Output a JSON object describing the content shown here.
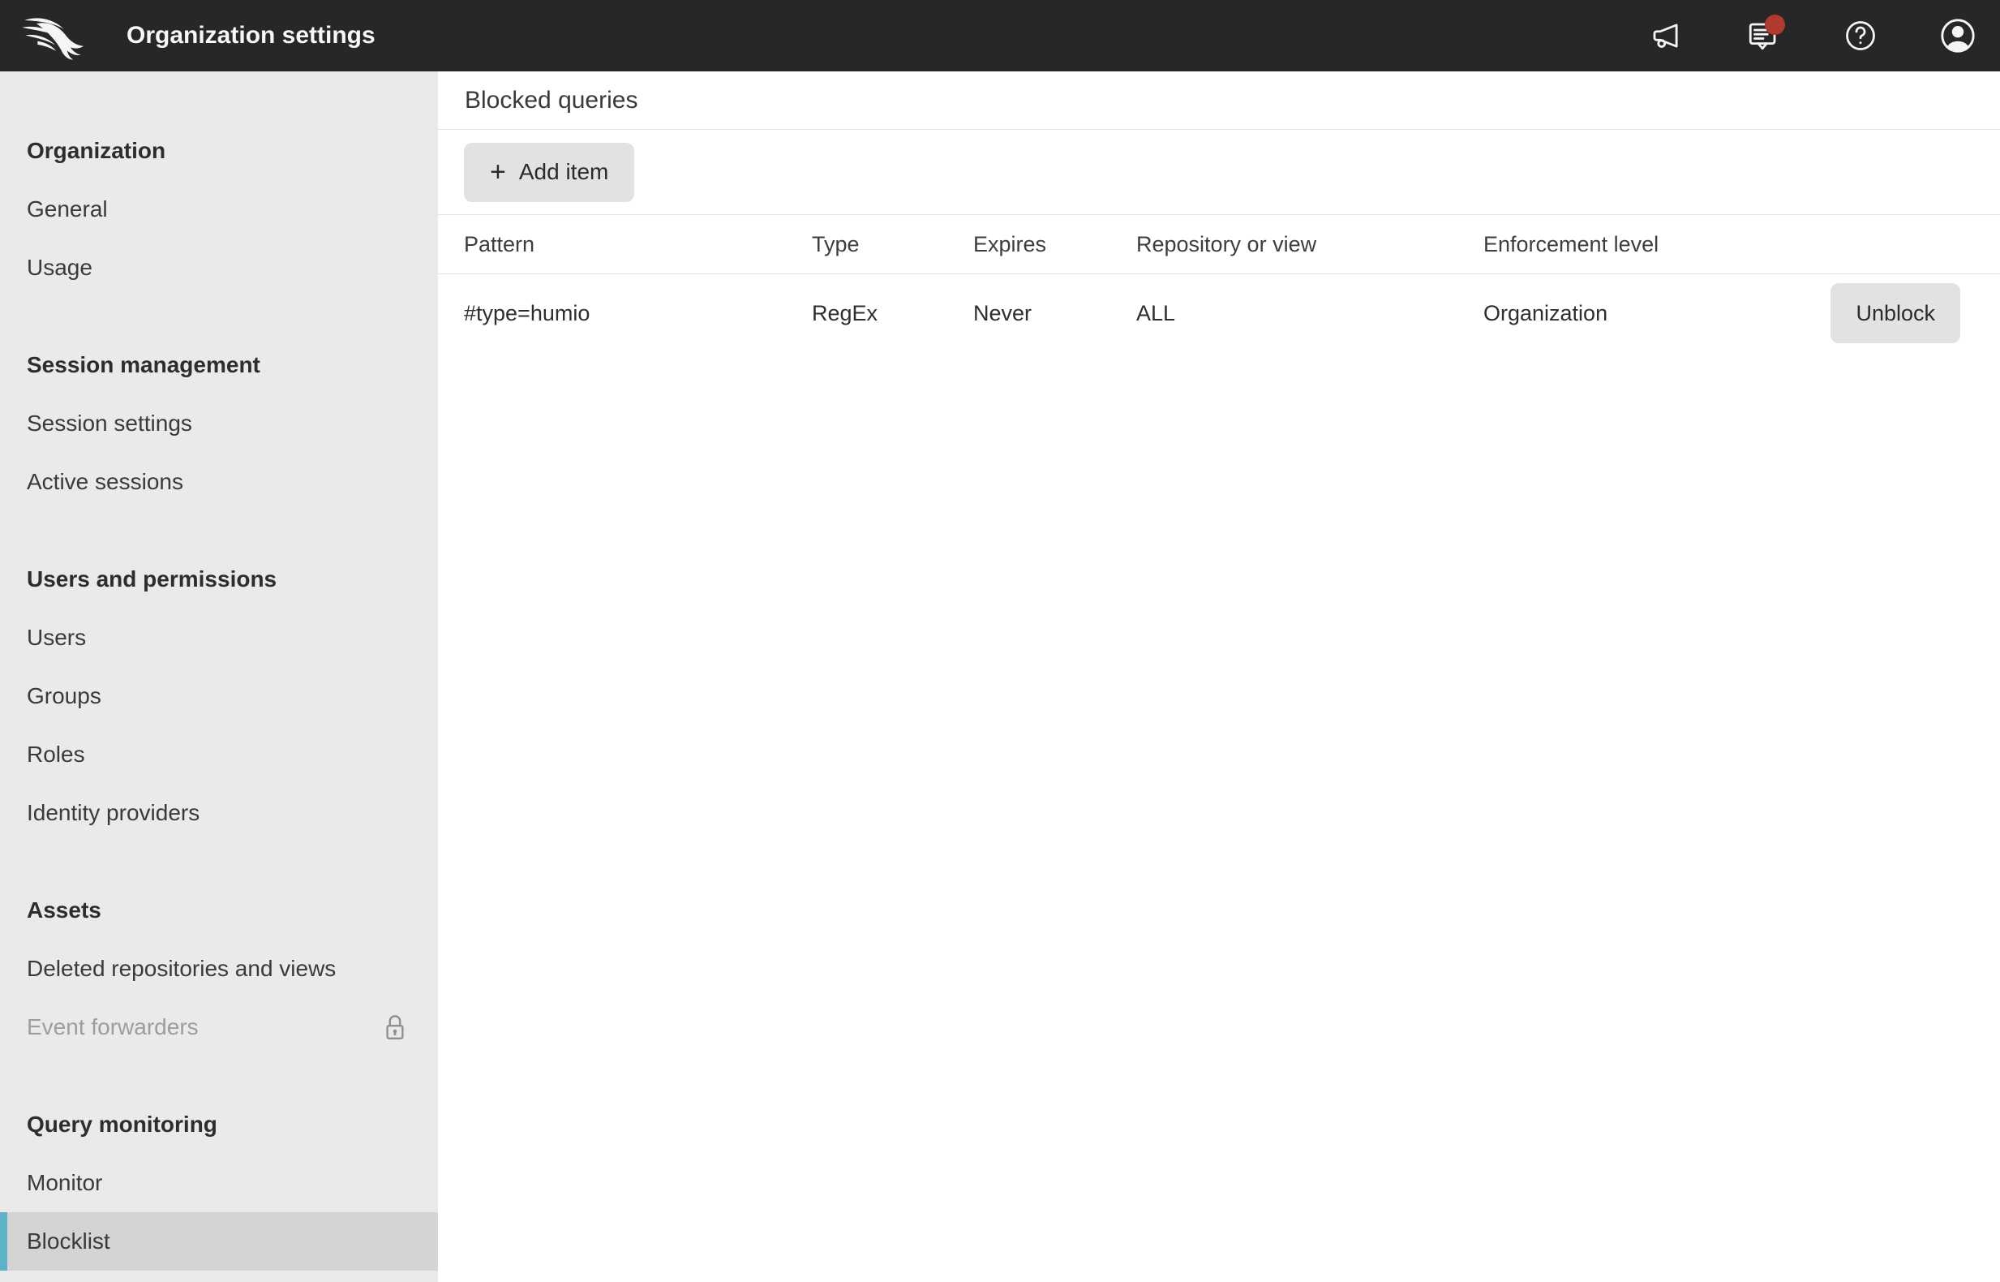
{
  "topbar": {
    "title": "Organization settings",
    "icons": [
      {
        "name": "megaphone-icon"
      },
      {
        "name": "chat-icon",
        "badge": true
      },
      {
        "name": "help-icon"
      },
      {
        "name": "avatar-icon"
      }
    ]
  },
  "sidebar": {
    "sections": [
      {
        "header": "Organization",
        "items": [
          {
            "label": "General"
          },
          {
            "label": "Usage"
          }
        ]
      },
      {
        "header": "Session management",
        "items": [
          {
            "label": "Session settings"
          },
          {
            "label": "Active sessions"
          }
        ]
      },
      {
        "header": "Users and permissions",
        "items": [
          {
            "label": "Users"
          },
          {
            "label": "Groups"
          },
          {
            "label": "Roles"
          },
          {
            "label": "Identity providers"
          }
        ]
      },
      {
        "header": "Assets",
        "items": [
          {
            "label": "Deleted repositories and views"
          },
          {
            "label": "Event forwarders",
            "locked": true
          }
        ]
      },
      {
        "header": "Query monitoring",
        "items": [
          {
            "label": "Monitor"
          },
          {
            "label": "Blocklist",
            "selected": true
          }
        ]
      }
    ]
  },
  "main": {
    "title": "Blocked queries",
    "add_button": {
      "icon": "+",
      "label": "Add item"
    },
    "table": {
      "columns": [
        "Pattern",
        "Type",
        "Expires",
        "Repository or view",
        "Enforcement level"
      ],
      "rows": [
        {
          "pattern": "#type=humio",
          "type": "RegEx",
          "expires": "Never",
          "repository": "ALL",
          "enforcement": "Organization",
          "action": "Unblock"
        }
      ]
    }
  },
  "colors": {
    "topbar_bg": "#272727",
    "badge_red": "#b03a2e",
    "sidebar_bg": "#eaeaea",
    "selected_bg": "#d4d4d4",
    "selected_accent": "#5cb3c6",
    "button_bg": "#e2e2e2",
    "divider": "#e4e4e4"
  }
}
